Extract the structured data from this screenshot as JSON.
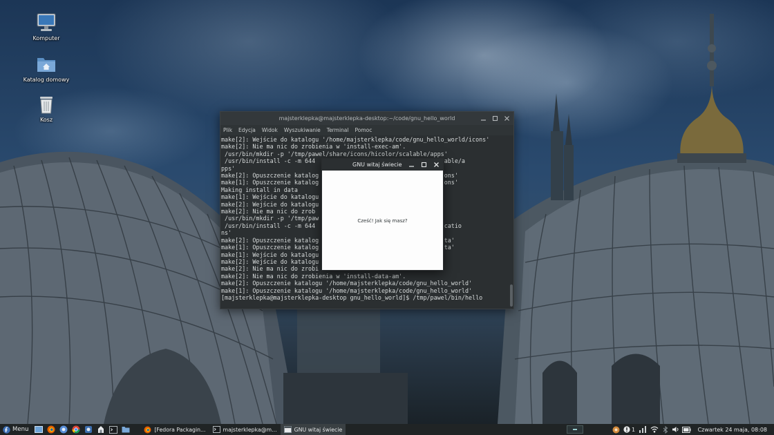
{
  "desktop": {
    "icons": [
      {
        "label": "Komputer",
        "icon": "computer-icon"
      },
      {
        "label": "Katalog domowy",
        "icon": "home-folder-icon"
      },
      {
        "label": "Kosz",
        "icon": "trash-icon"
      }
    ]
  },
  "terminal": {
    "title": "majsterklepka@majsterklepka-desktop:~/code/gnu_hello_world",
    "menu": [
      "Plik",
      "Edycja",
      "Widok",
      "Wyszukiwanie",
      "Terminal",
      "Pomoc"
    ],
    "lines": [
      "make[2]: Wejście do katalogu '/home/majsterklepka/code/gnu_hello_world/icons'",
      "make[2]: Nie ma nic do zrobienia w 'install-exec-am'.",
      " /usr/bin/mkdir -p '/tmp/pawel/share/icons/hicolor/scalable/apps'",
      " /usr/bin/install -c -m 644                        /hicolor/scalable/a",
      "pps'",
      "make[2]: Opuszczenie katalog                       ello_world/icons'",
      "make[1]: Opuszczenie katalog                       ello_world/icons'",
      "Making install in data",
      "make[1]: Wejście do katalogu                       _world/data'",
      "make[2]: Wejście do katalogu                       _world/data'",
      "make[2]: Nie ma nic do zrob",
      " /usr/bin/mkdir -p '/tmp/paw",
      " /usr/bin/install -c -m 644                       el/share/applicatio",
      "ns'",
      "make[2]: Opuszczenie katalog                       ello_world/data'",
      "make[1]: Opuszczenie katalog                       ello_world/data'",
      "make[1]: Wejście do katalogu                       _world'",
      "make[2]: Wejście do katalogu                       _world'",
      "make[2]: Nie ma nic do zrobi",
      "make[2]: Nie ma nic do zrobienia w 'install-data-am'.",
      "make[2]: Opuszczenie katalogu '/home/majsterklepka/code/gnu_hello_world'",
      "make[1]: Opuszczenie katalogu '/home/majsterklepka/code/gnu_hello_world'",
      "[majsterklepka@majsterklepka-desktop gnu_hello_world]$ /tmp/pawel/bin/hello"
    ]
  },
  "dialog": {
    "title": "GNU witaj świecie",
    "message": "Cześć! Jak się masz?"
  },
  "taskbar": {
    "menu_label": "Menu",
    "tasks": [
      {
        "label": "[Fedora Packagin...",
        "icon": "firefox-icon"
      },
      {
        "label": "majsterklepka@m...",
        "icon": "terminal-icon"
      },
      {
        "label": "GNU witaj świecie",
        "icon": "window-icon"
      }
    ],
    "notification_count": "1",
    "clock": "Czwartek 24 maja, 08:08"
  }
}
